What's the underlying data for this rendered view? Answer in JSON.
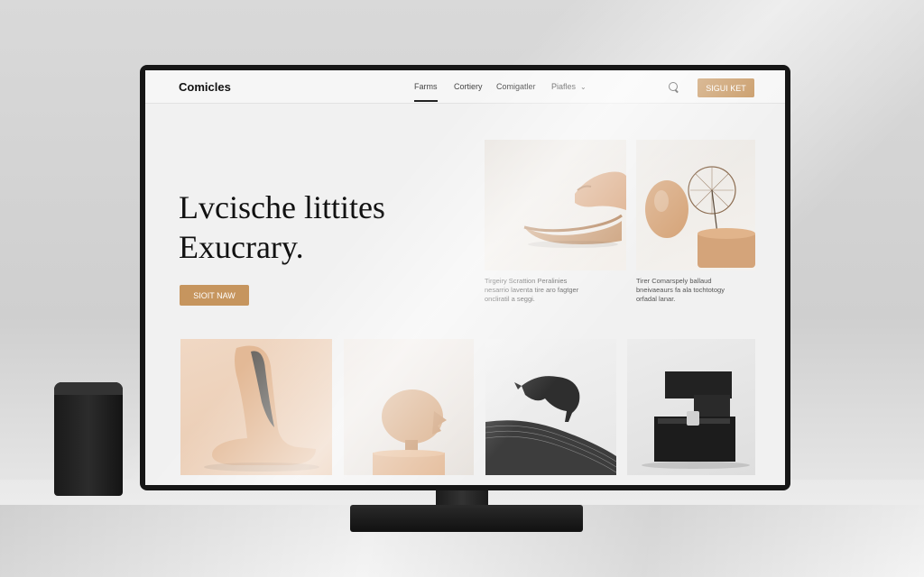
{
  "app": {
    "logo": "Comicles",
    "nav": [
      {
        "label": "Farms"
      },
      {
        "label": "Cortiery"
      },
      {
        "label": "Comigatler"
      },
      {
        "label": "Piafles"
      }
    ],
    "signin_label": "SIGUI KET"
  },
  "hero": {
    "title_line1": "Lvcische littites",
    "title_line2": "Exucrary.",
    "cta_label": "SIOIT NAW"
  },
  "featured": [
    {
      "caption_lines": [
        "Tirgeiry Scrattion Peralinies",
        "nesarrio laventa tire aro fagtger",
        "oncliratil a seggi."
      ],
      "icon": "clay-hand-sculpture"
    },
    {
      "caption_lines": [
        "Tirer Comarspely ballaud",
        "bneivaeaurs fa ala tochtotogy",
        "orfadal lanar."
      ],
      "icon": "wooden-egg-and-wire-sphere"
    }
  ],
  "gallery": [
    {
      "icon": "abstract-clay-curve"
    },
    {
      "icon": "clay-head-bust"
    },
    {
      "icon": "wire-animal-on-wave"
    },
    {
      "icon": "black-cube-sculpture"
    }
  ],
  "colors": {
    "accent": "#c6955e",
    "screen_bg": "#f1f1f1",
    "bezel": "#161616"
  }
}
